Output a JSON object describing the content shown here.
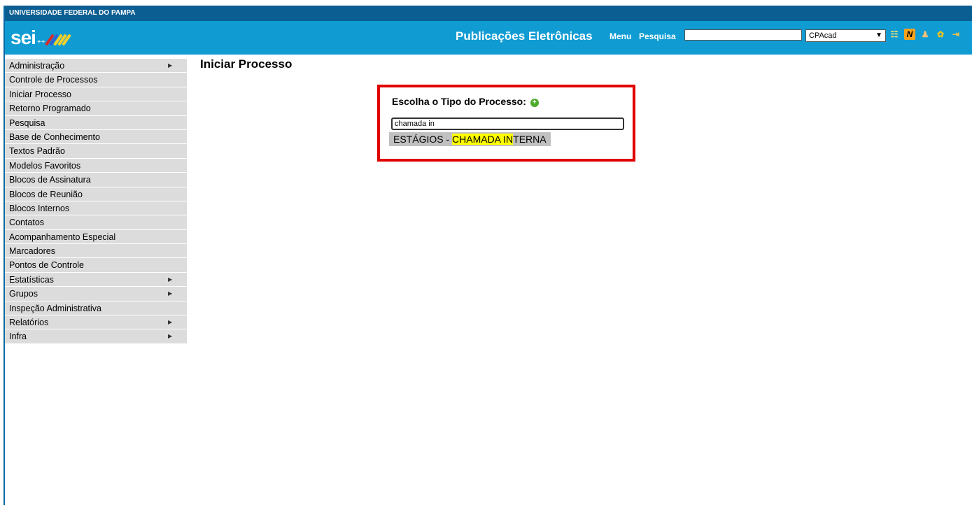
{
  "header": {
    "university": "UNIVERSIDADE FEDERAL DO PAMPA",
    "logo_text": "sei",
    "logo_suffix": "++",
    "title": "Publicações Eletrônicas",
    "menu_link": "Menu",
    "search_link": "Pesquisa",
    "search_value": "",
    "unit_selected": "CPAcad",
    "icons": [
      "list-icon",
      "notifications-icon",
      "user-icon",
      "settings-icon",
      "exit-icon"
    ]
  },
  "sidebar": {
    "items": [
      {
        "label": "Administração",
        "submenu": true
      },
      {
        "label": "Controle de Processos",
        "submenu": false
      },
      {
        "label": "Iniciar Processo",
        "submenu": false
      },
      {
        "label": "Retorno Programado",
        "submenu": false
      },
      {
        "label": "Pesquisa",
        "submenu": false
      },
      {
        "label": "Base de Conhecimento",
        "submenu": false
      },
      {
        "label": "Textos Padrão",
        "submenu": false
      },
      {
        "label": "Modelos Favoritos",
        "submenu": false
      },
      {
        "label": "Blocos de Assinatura",
        "submenu": false
      },
      {
        "label": "Blocos de Reunião",
        "submenu": false
      },
      {
        "label": "Blocos Internos",
        "submenu": false
      },
      {
        "label": "Contatos",
        "submenu": false
      },
      {
        "label": "Acompanhamento Especial",
        "submenu": false
      },
      {
        "label": "Marcadores",
        "submenu": false
      },
      {
        "label": "Pontos de Controle",
        "submenu": false
      },
      {
        "label": "Estatísticas",
        "submenu": true
      },
      {
        "label": "Grupos",
        "submenu": true
      },
      {
        "label": "Inspeção Administrativa",
        "submenu": false
      },
      {
        "label": "Relatórios",
        "submenu": true
      },
      {
        "label": "Infra",
        "submenu": true
      }
    ]
  },
  "main": {
    "page_title": "Iniciar Processo",
    "choose_label": "Escolha o Tipo do Processo:",
    "process_input_value": "chamada in",
    "suggestion": {
      "prefix": "ESTÁGIOS - ",
      "highlight": "CHAMADA IN",
      "suffix": "TERNA"
    }
  },
  "colors": {
    "header_blue": "#109cd3",
    "topbar_blue": "#0b5e92",
    "sidebar_gray": "#dcdcdc",
    "highlight_box": "#e00000",
    "match_highlight": "#ffff00"
  }
}
